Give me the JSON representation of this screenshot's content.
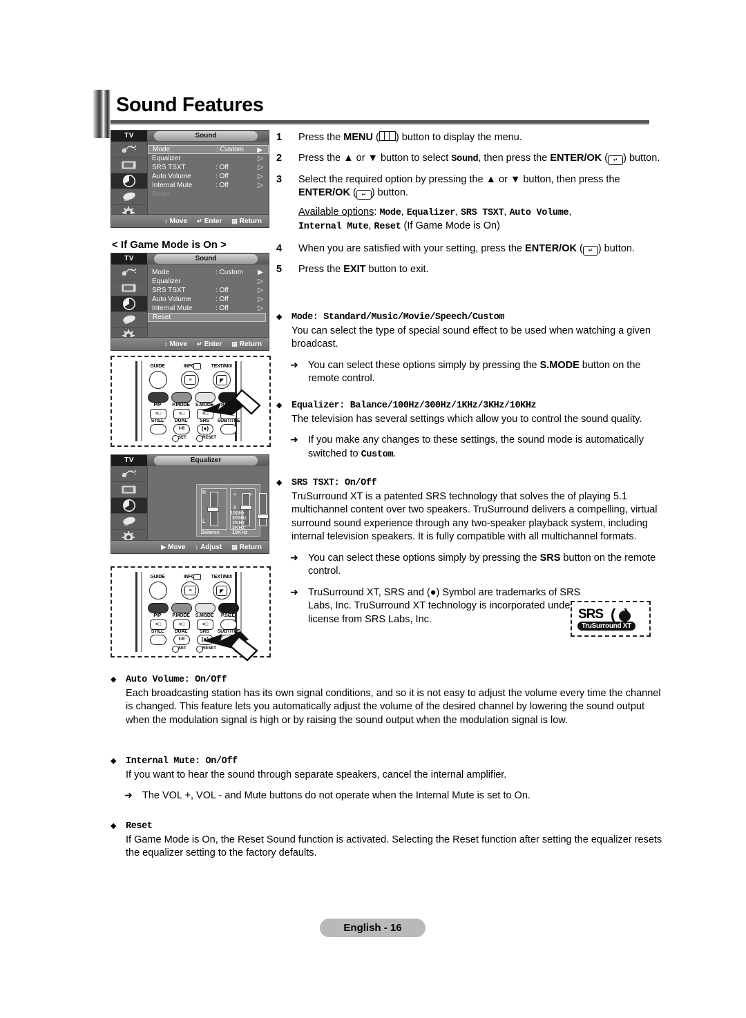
{
  "document": {
    "title": "Sound Features",
    "footer_label": "English - 16"
  },
  "osd_sound": {
    "tv_label": "TV",
    "title": "Sound",
    "rows": [
      {
        "label": "Mode",
        "value": ": Custom",
        "arrow": "▶",
        "state": "highlighted"
      },
      {
        "label": "Equalizer",
        "value": "",
        "arrow": "▷",
        "state": "normal"
      },
      {
        "label": "SRS TSXT",
        "value": ": Off",
        "arrow": "▷",
        "state": "normal"
      },
      {
        "label": "Auto Volume",
        "value": ": Off",
        "arrow": "▷",
        "state": "normal"
      },
      {
        "label": "Internal Mute",
        "value": ": Off",
        "arrow": "▷",
        "state": "normal"
      },
      {
        "label": "Reset",
        "value": "",
        "arrow": "",
        "state": "disabled"
      }
    ],
    "nav": {
      "move": "Move",
      "enter": "Enter",
      "return": "Return"
    }
  },
  "game_mode": {
    "caption": "< If Game Mode is On >",
    "osd": {
      "tv_label": "TV",
      "title": "Sound",
      "rows": [
        {
          "label": "Mode",
          "value": ": Custom",
          "arrow": "▶",
          "state": "normal"
        },
        {
          "label": "Equalizer",
          "value": "",
          "arrow": "▷",
          "state": "normal"
        },
        {
          "label": "SRS TSXT",
          "value": ": Off",
          "arrow": "▷",
          "state": "normal"
        },
        {
          "label": "Auto Volume",
          "value": ": Off",
          "arrow": "▷",
          "state": "normal"
        },
        {
          "label": "Internal Mute",
          "value": ": Off",
          "arrow": "▷",
          "state": "normal"
        },
        {
          "label": "Reset",
          "value": "",
          "arrow": "",
          "state": "highlighted"
        }
      ],
      "nav": {
        "move": "Move",
        "enter": "Enter",
        "return": "Return"
      }
    }
  },
  "osd_equalizer": {
    "tv_label": "TV",
    "title": "Equalizer",
    "balance_label": "Balance",
    "balance_top": "R",
    "balance_bottom": "L",
    "plus": "+",
    "zero": "0",
    "minus": "–",
    "bands": [
      "100Hz",
      "300Hz",
      "1KHz",
      "3KHz",
      "10KHz"
    ],
    "nav": {
      "move": "Move",
      "adjust": "Adjust",
      "return": "Return"
    }
  },
  "remote_smode": {
    "top_labels": [
      "GUIDE",
      "INFO",
      "TEXT/MIX"
    ],
    "row1_labels": [
      "PIP",
      "P.MODE",
      "S.MODE",
      "P.SIZE"
    ],
    "row2_labels": [
      "STILL",
      "DUAL",
      "SRS",
      "SUBTITLE"
    ],
    "dual_text": "I-II",
    "set_label": "SET",
    "reset_label": "RESET",
    "pointed_key": "S.MODE"
  },
  "remote_srs": {
    "top_labels": [
      "GUIDE",
      "INFO",
      "TEXT/MIX"
    ],
    "row1_labels": [
      "PIP",
      "P.MODE",
      "S.MODE",
      "P.SIZE"
    ],
    "row2_labels": [
      "STILL",
      "DUAL",
      "SRS",
      "SUBTITLE"
    ],
    "dual_text": "I-II",
    "set_label": "SET",
    "reset_label": "RESET",
    "pointed_key": "SRS"
  },
  "steps": [
    {
      "num": "1",
      "html": "Press the <b>MENU</b> (<span class=\"kbd-menu\"><i style=\"left:6px\"></i><i style=\"left:13px\"></i></span>) button to display the menu."
    },
    {
      "num": "2",
      "html": "Press the ▲ or ▼ button to select <span class=\"mono\">Sound</span>, then press the <b>ENTER/OK</b> (<span class=\"kbd-ent\">↵</span>) button."
    },
    {
      "num": "3",
      "html": "Select the required option by pressing the ▲ or ▼ button, then press the <b>ENTER/OK</b> (<span class=\"kbd-ent\">↵</span>) button."
    },
    {
      "num": "",
      "html": "<span class=\"u\">Available options</span>: <span class=\"mono\">Mode</span>, <span class=\"mono\">Equalizer</span>, <span class=\"mono\">SRS TSXT</span>, <span class=\"mono\">Auto Volume</span>,<br><span class=\"mono\">Internal Mute</span>, <span class=\"mono\">Reset</span> (If Game Mode is On)"
    },
    {
      "num": "4",
      "html": "When you are satisfied with your setting, press the <b>ENTER/OK</b> (<span class=\"kbd-ent\">↵</span>) button."
    },
    {
      "num": "5",
      "html": "Press the <b>EXIT</b> button to exit."
    }
  ],
  "sections": [
    {
      "id": "mode",
      "heading": "Mode: Standard/Music/Movie/Speech/Custom",
      "body": "You can select the type of special sound effect to be used when watching a given broadcast.",
      "note": "You can select these options simply by pressing the <b>S.MODE</b> button on the remote control."
    },
    {
      "id": "equalizer",
      "heading": "Equalizer: Balance/100Hz/300Hz/1KHz/3KHz/10KHz",
      "body": "The television has several settings which allow you to control the sound quality.",
      "note": "If you make any changes to these settings, the sound mode is automatically switched to <span class=\"mono\">Custom</span>."
    },
    {
      "id": "srs-tsxt",
      "heading": "SRS TSXT: On/Off",
      "body": "TruSurround XT is a patented SRS technology that solves the of playing 5.1 multichannel content over two speakers. TruSurround delivers a compelling, virtual surround sound experience through any two-speaker playback system, including internal television speakers. It is fully compatible with all multichannel formats.",
      "note": "You can select these options simply by pressing the <b>SRS</b> button on the remote control.",
      "note2": "TruSurround XT, SRS and (●) Symbol are trademarks of SRS Labs, Inc. TruSurround XT technology is incorporated under license from SRS Labs, Inc."
    },
    {
      "id": "auto-volume",
      "heading": "Auto Volume: On/Off",
      "body": "Each broadcasting station has its own signal conditions, and so it is not easy to adjust the volume every time the channel is changed. This feature lets you automatically adjust the volume of the desired channel by lowering the sound output when the modulation signal is high or by raising the sound output when the modulation signal is low."
    },
    {
      "id": "internal-mute",
      "heading": "Internal Mute: On/Off",
      "body": "If you want to hear the sound through separate speakers, cancel the internal amplifier.",
      "note": "The VOL +, VOL - and Mute buttons do not operate when the Internal Mute is set to On."
    },
    {
      "id": "reset",
      "heading": "Reset",
      "body": "If Game Mode is On, the Reset Sound function is activated. Selecting the Reset function after setting the equalizer resets the equalizer setting to the factory defaults."
    }
  ],
  "srs_logo": {
    "line1": "SRS",
    "line2": "TruSurround XT"
  }
}
